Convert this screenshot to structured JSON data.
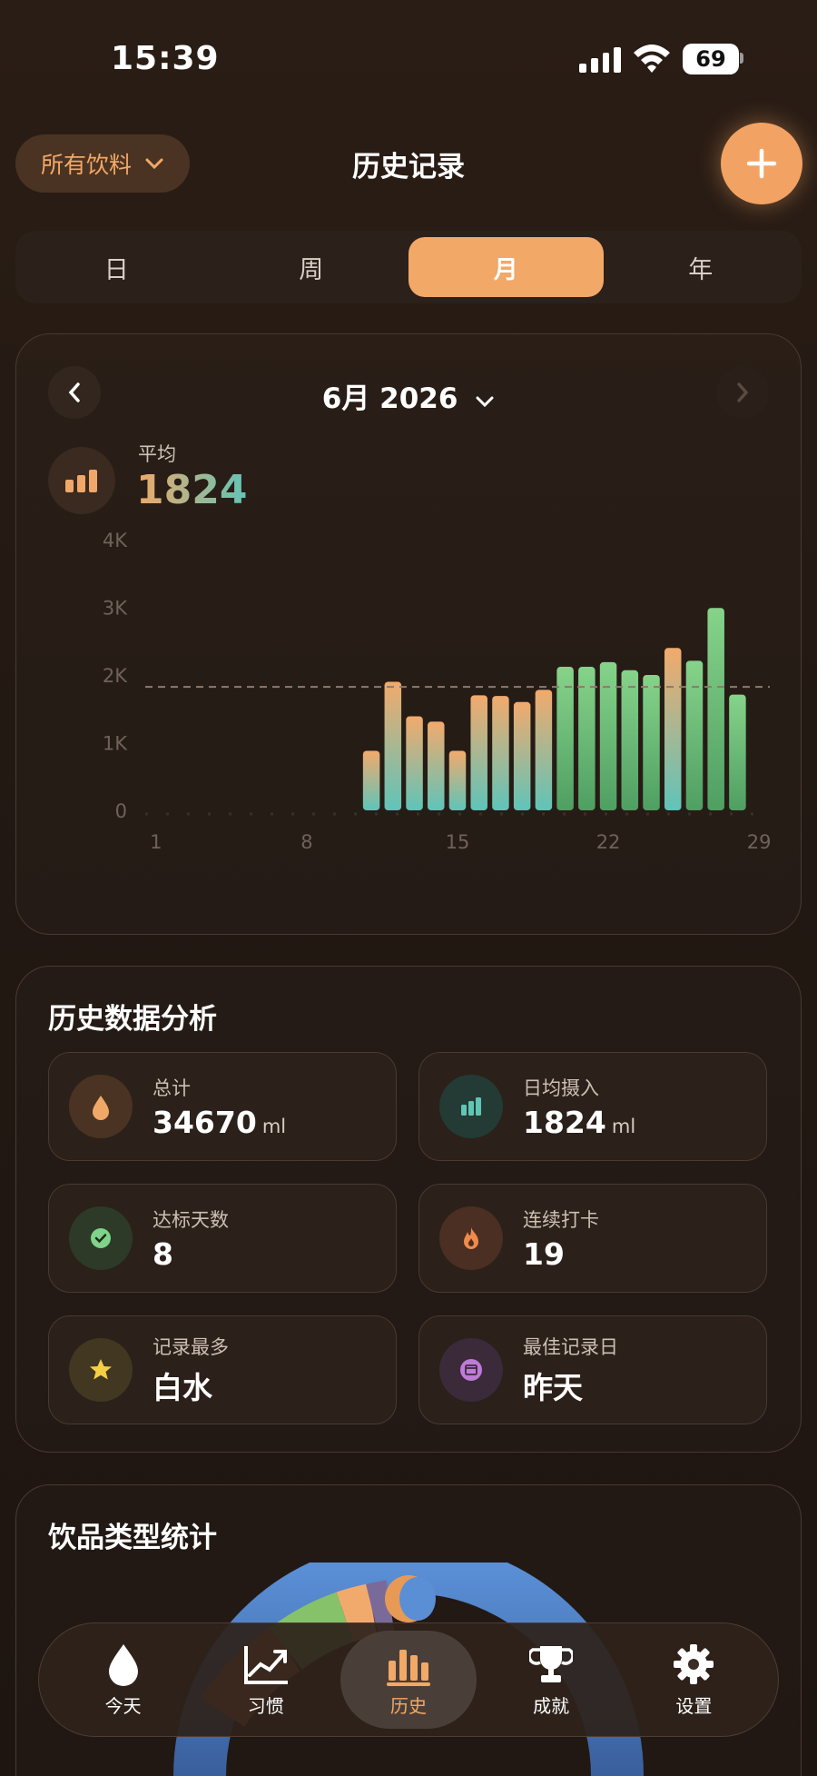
{
  "status_bar": {
    "time": "15:39",
    "battery": "69"
  },
  "header": {
    "filter_label": "所有饮料",
    "title": "历史记录"
  },
  "segments": [
    {
      "label": "日",
      "active": false
    },
    {
      "label": "周",
      "active": false
    },
    {
      "label": "月",
      "active": true
    },
    {
      "label": "年",
      "active": false
    }
  ],
  "chart_card": {
    "month": "6月 2026",
    "avg_label": "平均",
    "avg_value": "1824"
  },
  "chart_data": {
    "type": "bar",
    "x": [
      1,
      2,
      3,
      4,
      5,
      6,
      7,
      8,
      9,
      10,
      11,
      12,
      13,
      14,
      15,
      16,
      17,
      18,
      19,
      20,
      21,
      22,
      23,
      24,
      25,
      26,
      27,
      28,
      29
    ],
    "values": [
      0,
      0,
      0,
      0,
      0,
      0,
      0,
      0,
      0,
      0,
      880,
      1900,
      1390,
      1310,
      880,
      1700,
      1690,
      1600,
      1780,
      2120,
      2120,
      2190,
      2070,
      2000,
      2400,
      2210,
      2990,
      1710
    ],
    "goal_met": [
      false,
      false,
      false,
      false,
      false,
      false,
      false,
      false,
      false,
      false,
      false,
      false,
      false,
      false,
      false,
      false,
      false,
      false,
      false,
      true,
      true,
      true,
      true,
      true,
      false,
      true,
      true,
      true,
      false
    ],
    "average_line": 1824,
    "ylim": [
      0,
      4000
    ],
    "yticks": [
      "0",
      "1K",
      "2K",
      "3K",
      "4K"
    ],
    "xticks": [
      "1",
      "8",
      "15",
      "22",
      "29"
    ],
    "colors": {
      "normal_top": "#f2aa6c",
      "normal_bottom": "#5fc4b9",
      "goal_top": "#86d38a",
      "goal_bottom": "#4f9f62"
    }
  },
  "analysis": {
    "title": "历史数据分析",
    "stats": [
      {
        "label": "总计",
        "value": "34670",
        "unit": "ml",
        "icon": "water-drop-icon",
        "color": "#f0a868",
        "bg": "#4a3322"
      },
      {
        "label": "日均摄入",
        "value": "1824",
        "unit": "ml",
        "icon": "bar-chart-icon",
        "color": "#62c4b6",
        "bg": "#243a34"
      },
      {
        "label": "达标天数",
        "value": "8",
        "unit": "",
        "icon": "check-circle-icon",
        "color": "#7fd38a",
        "bg": "#2c3a27"
      },
      {
        "label": "连续打卡",
        "value": "19",
        "unit": "",
        "icon": "flame-icon",
        "color": "#f08a4a",
        "bg": "#4a2f22"
      },
      {
        "label": "记录最多",
        "value": "白水",
        "unit": "",
        "icon": "star-icon",
        "color": "#f5cf45",
        "bg": "#423720"
      },
      {
        "label": "最佳记录日",
        "value": "昨天",
        "unit": "",
        "icon": "calendar-icon",
        "color": "#c07ad8",
        "bg": "#3a2a3a"
      }
    ]
  },
  "types": {
    "title": "饮品类型统计"
  },
  "tabbar": [
    {
      "label": "今天",
      "icon": "water-drop-icon",
      "active": false
    },
    {
      "label": "习惯",
      "icon": "trend-chart-icon",
      "active": false
    },
    {
      "label": "历史",
      "icon": "bar-chart-icon",
      "active": true
    },
    {
      "label": "成就",
      "icon": "trophy-icon",
      "active": false
    },
    {
      "label": "设置",
      "icon": "gear-icon",
      "active": false
    }
  ]
}
